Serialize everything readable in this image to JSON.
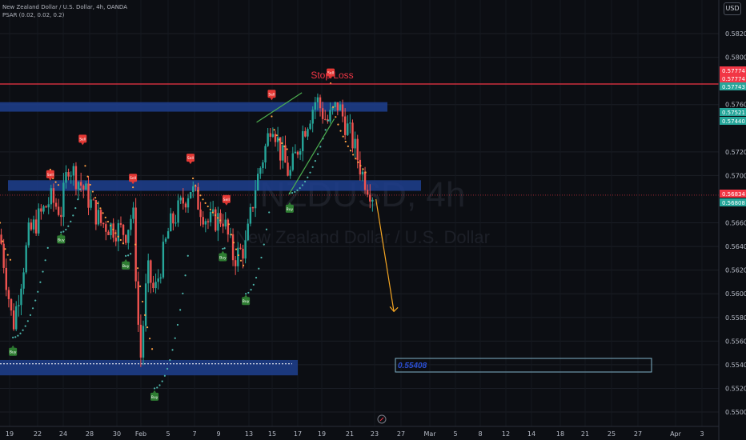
{
  "legend": {
    "line1": "New Zealand Dollar / U.S. Dollar, 4h, OANDA",
    "line2": "PSAR (0.02, 0.02, 0.2)"
  },
  "currency_button": "USD",
  "watermark": {
    "symbol": "NZDUSD, 4h",
    "name": "New Zealand Dollar / U.S. Dollar"
  },
  "colors": {
    "background": "#0c0e13",
    "up": "#26a69a",
    "down": "#ef5350",
    "psar_up": "#4db6ac",
    "psar_down": "#ff9f43",
    "zone": "#1e3f8f",
    "stoploss": "#f23645",
    "trend": "#4caf50",
    "arrow": "#f5a623"
  },
  "annotations": {
    "stop_loss": "Stop Loss",
    "target_label": "0.55408",
    "buy": "Buy",
    "sell": "Sell",
    "sell_small": "Sell"
  },
  "chart_data": {
    "type": "candlestick",
    "ylim": [
      0.549,
      0.584
    ],
    "y_ticks": [
      "0.58200",
      "0.58000",
      "0.57600",
      "0.57200",
      "0.57000",
      "0.56600",
      "0.56400",
      "0.56200",
      "0.56000",
      "0.55800",
      "0.55600",
      "0.55400",
      "0.55200",
      "0.55000"
    ],
    "x_ticks": [
      "19",
      "22",
      "24",
      "28",
      "30",
      "Feb",
      "5",
      "7",
      "9",
      "13",
      "15",
      "17",
      "19",
      "21",
      "23",
      "27",
      "Mar",
      "5",
      "8",
      "12",
      "14",
      "18",
      "21",
      "25",
      "27",
      "Apr",
      "3"
    ],
    "price_tags": [
      {
        "value": "0.57774",
        "color": "#f23645"
      },
      {
        "value": "0.57774",
        "color": "#f23645"
      },
      {
        "value": "0.57743",
        "color": "#26a69a"
      },
      {
        "value": "0.57521",
        "color": "#26a69a"
      },
      {
        "value": "0.57440",
        "color": "#26a69a"
      },
      {
        "value": "0.56834",
        "color": "#f23645"
      },
      {
        "value": "0.56808",
        "color": "#26a69a"
      }
    ],
    "stop_loss_level": 0.57774,
    "target_level": 0.55408,
    "zones": [
      {
        "from": 0.5754,
        "to": 0.5762
      },
      {
        "from": 0.5687,
        "to": 0.5696
      },
      {
        "from": 0.5531,
        "to": 0.5544
      }
    ],
    "signals": [
      {
        "type": "sell",
        "time": 0.07,
        "price": 0.5695
      },
      {
        "type": "sell",
        "time": 0.115,
        "price": 0.5725
      },
      {
        "type": "sell",
        "time": 0.185,
        "price": 0.5692
      },
      {
        "type": "sell",
        "time": 0.265,
        "price": 0.5709
      },
      {
        "type": "sell",
        "time": 0.315,
        "price": 0.5674
      },
      {
        "type": "sell",
        "time": 0.378,
        "price": 0.5763
      },
      {
        "type": "sell",
        "time": 0.46,
        "price": 0.5781
      },
      {
        "type": "buy",
        "time": 0.018,
        "price": 0.5557
      },
      {
        "type": "buy",
        "time": 0.085,
        "price": 0.5652
      },
      {
        "type": "buy",
        "time": 0.175,
        "price": 0.563
      },
      {
        "type": "buy",
        "time": 0.215,
        "price": 0.5519
      },
      {
        "type": "buy",
        "time": 0.31,
        "price": 0.5637
      },
      {
        "type": "buy",
        "time": 0.342,
        "price": 0.56
      },
      {
        "type": "buy",
        "time": 0.403,
        "price": 0.5678
      }
    ],
    "psar": {
      "segments": [
        {
          "dir": "down",
          "t0": 0.0,
          "t1": 0.018,
          "p0": 0.566,
          "p1": 0.5625
        },
        {
          "dir": "up",
          "t0": 0.018,
          "t1": 0.07,
          "p0": 0.5563,
          "p1": 0.565
        },
        {
          "dir": "down",
          "t0": 0.07,
          "t1": 0.085,
          "p0": 0.5705,
          "p1": 0.569
        },
        {
          "dir": "up",
          "t0": 0.085,
          "t1": 0.115,
          "p0": 0.5652,
          "p1": 0.5698
        },
        {
          "dir": "down",
          "t0": 0.115,
          "t1": 0.175,
          "p0": 0.573,
          "p1": 0.564
        },
        {
          "dir": "up",
          "t0": 0.175,
          "t1": 0.185,
          "p0": 0.5632,
          "p1": 0.5636
        },
        {
          "dir": "down",
          "t0": 0.185,
          "t1": 0.215,
          "p0": 0.569,
          "p1": 0.5545
        },
        {
          "dir": "up",
          "t0": 0.215,
          "t1": 0.265,
          "p0": 0.552,
          "p1": 0.565
        },
        {
          "dir": "down",
          "t0": 0.265,
          "t1": 0.31,
          "p0": 0.5712,
          "p1": 0.566
        },
        {
          "dir": "up",
          "t0": 0.31,
          "t1": 0.315,
          "p0": 0.5638,
          "p1": 0.564
        },
        {
          "dir": "down",
          "t0": 0.315,
          "t1": 0.342,
          "p0": 0.568,
          "p1": 0.562
        },
        {
          "dir": "up",
          "t0": 0.342,
          "t1": 0.378,
          "p0": 0.56,
          "p1": 0.5685
        },
        {
          "dir": "down",
          "t0": 0.378,
          "t1": 0.403,
          "p0": 0.575,
          "p1": 0.572
        },
        {
          "dir": "up",
          "t0": 0.403,
          "t1": 0.46,
          "p0": 0.5685,
          "p1": 0.5755
        },
        {
          "dir": "down",
          "t0": 0.46,
          "t1": 0.512,
          "p0": 0.5778,
          "p1": 0.57
        }
      ]
    },
    "trend_lines": [
      {
        "t0": 0.357,
        "p0": 0.5745,
        "t1": 0.42,
        "p1": 0.577
      },
      {
        "t0": 0.402,
        "p0": 0.5684,
        "t1": 0.465,
        "p1": 0.5748
      }
    ],
    "projection": {
      "t0": 0.523,
      "p0": 0.568,
      "t1": 0.548,
      "p1": 0.5585
    }
  }
}
